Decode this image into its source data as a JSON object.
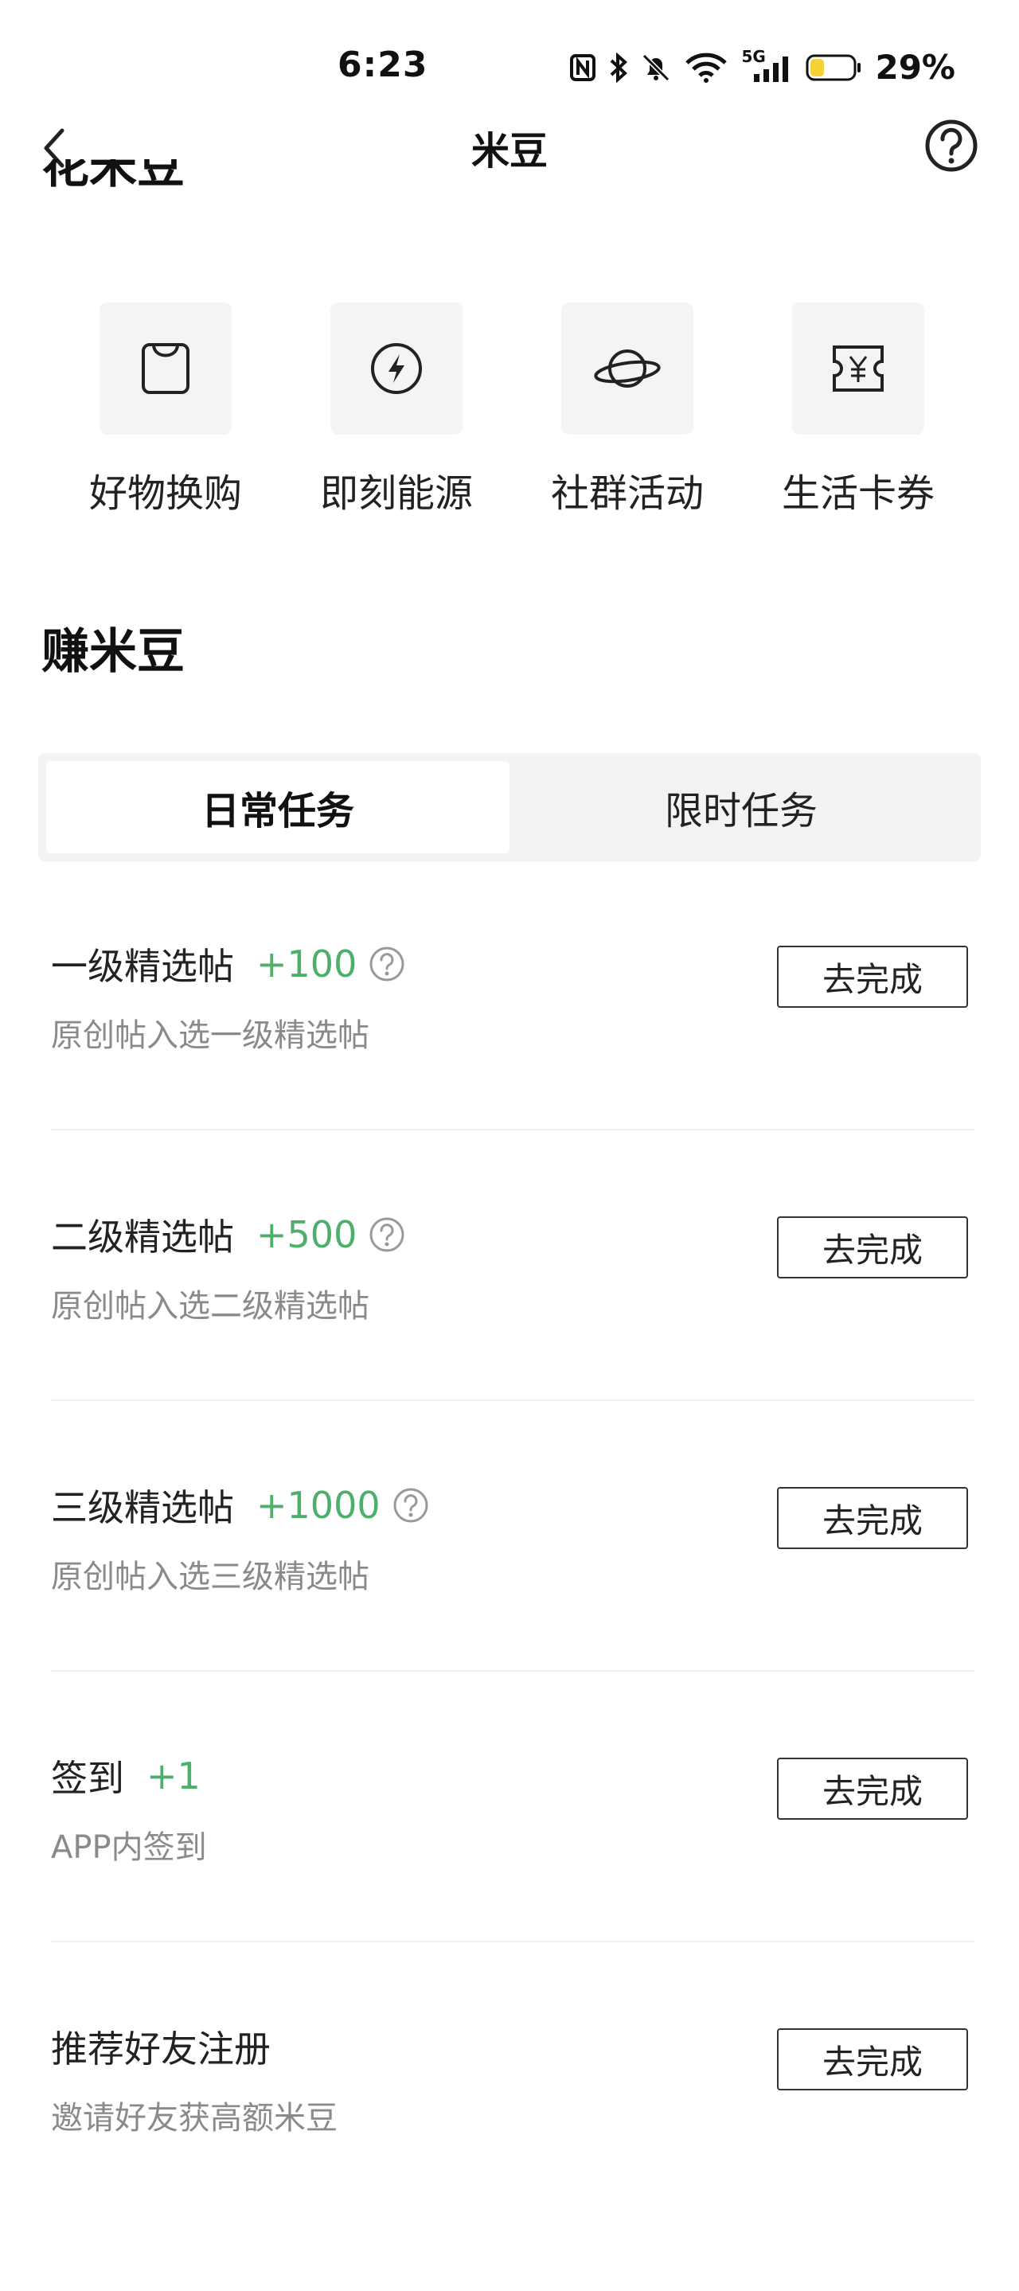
{
  "status_bar": {
    "time": "6:23",
    "battery": "29%",
    "network": "5G"
  },
  "nav": {
    "title": "米豆"
  },
  "spend_section": {
    "title_partial": "花米豆",
    "items": [
      {
        "label": "好物换购",
        "icon": "shopping-bag-icon"
      },
      {
        "label": "即刻能源",
        "icon": "lightning-circle-icon"
      },
      {
        "label": "社群活动",
        "icon": "planet-icon"
      },
      {
        "label": "生活卡券",
        "icon": "yen-coupon-icon"
      }
    ]
  },
  "earn_section": {
    "title": "赚米豆",
    "tabs": [
      {
        "label": "日常任务",
        "active": true
      },
      {
        "label": "限时任务",
        "active": false
      }
    ],
    "tasks": [
      {
        "title": "一级精选帖",
        "points": "+100",
        "has_help": true,
        "desc": "原创帖入选一级精选帖",
        "button": "去完成"
      },
      {
        "title": "二级精选帖",
        "points": "+500",
        "has_help": true,
        "desc": "原创帖入选二级精选帖",
        "button": "去完成"
      },
      {
        "title": "三级精选帖",
        "points": "+1000",
        "has_help": true,
        "desc": "原创帖入选三级精选帖",
        "button": "去完成"
      },
      {
        "title": "签到",
        "points": "+1",
        "has_help": false,
        "desc": "APP内签到",
        "button": "去完成"
      },
      {
        "title": "推荐好友注册",
        "points": "",
        "has_help": false,
        "desc": "邀请好友获高额米豆",
        "button": "去完成"
      }
    ]
  },
  "colors": {
    "points_green": "#4caf6a",
    "tile_bg": "#f4f4f4",
    "battery_yellow": "#f5d23a"
  }
}
